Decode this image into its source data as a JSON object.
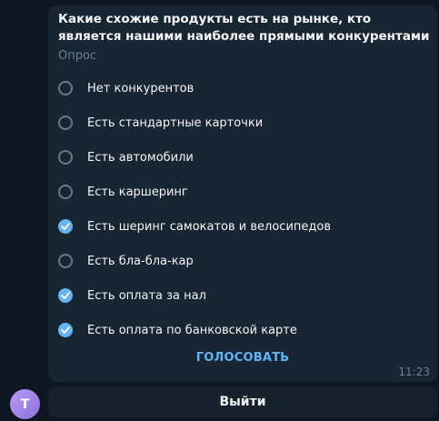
{
  "poll": {
    "question": "Какие схожие продукты есть на рынке, кто является нашими наиболее прямыми конкурентами",
    "type_label": "Опрос",
    "options": [
      {
        "label": "Нет конкурентов",
        "checked": false
      },
      {
        "label": "Есть стандартные карточки",
        "checked": false
      },
      {
        "label": "Есть автомобили",
        "checked": false
      },
      {
        "label": "Есть каршеринг",
        "checked": false
      },
      {
        "label": "Есть шеринг самокатов и велосипедов",
        "checked": true
      },
      {
        "label": "Есть бла-бла-кар",
        "checked": false
      },
      {
        "label": "Есть оплата за нал",
        "checked": true
      },
      {
        "label": "Есть оплата по банковской карте",
        "checked": true
      }
    ],
    "vote_label": "ГОЛОСОВАТЬ",
    "time": "11:23"
  },
  "avatar": {
    "initial": "T",
    "icon": "user-avatar-icon"
  },
  "exit_button": {
    "label": "Выйти"
  },
  "colors": {
    "background": "#0e1621",
    "bubble": "#182533",
    "accent": "#64b5ef",
    "vote": "#5eb5f7"
  }
}
